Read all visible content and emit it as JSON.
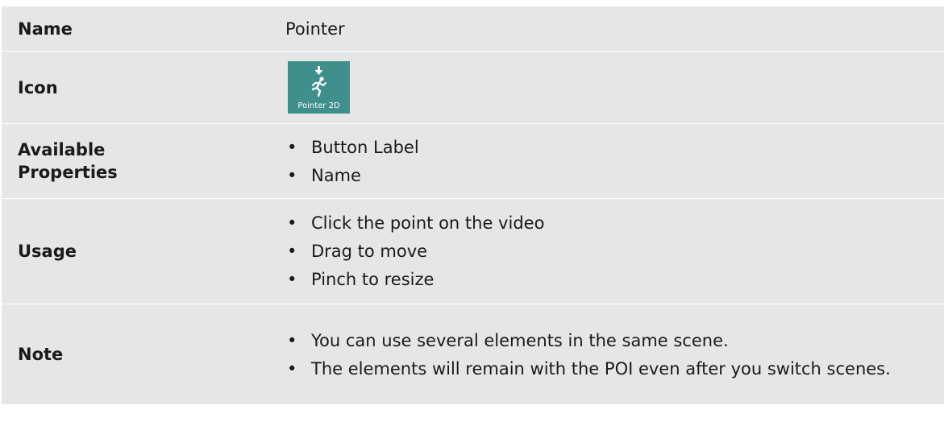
{
  "table": {
    "rows": {
      "name": {
        "label": "Name",
        "value": "Pointer"
      },
      "icon": {
        "label": "Icon",
        "icon_name": "pointer-2d-icon",
        "icon_caption": "Pointer 2D",
        "icon_bg_color": "#3f8f8c"
      },
      "properties": {
        "label_line1": "Available",
        "label_line2": "Properties",
        "items": [
          "Button Label",
          "Name"
        ]
      },
      "usage": {
        "label": "Usage",
        "items": [
          "Click the point on the video",
          "Drag to move",
          "Pinch to resize"
        ]
      },
      "note": {
        "label": "Note",
        "items": [
          "You can use several elements in the same scene.",
          "The elements will remain with the POI even after you switch scenes."
        ]
      }
    },
    "row_bg_color": "#e6e6e6"
  }
}
